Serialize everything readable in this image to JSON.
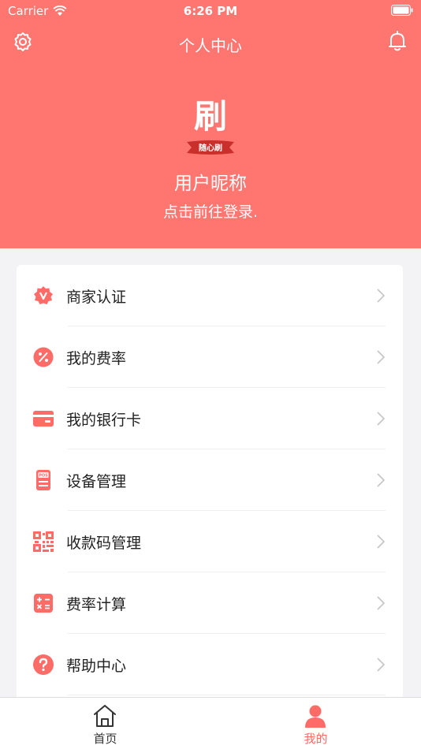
{
  "status_bar": {
    "carrier": "Carrier",
    "time": "6:26 PM"
  },
  "navbar": {
    "title": "个人中心",
    "icons": {
      "left": "settings-gear-icon",
      "right": "notification-bell-icon"
    }
  },
  "profile": {
    "logo_char": "刷",
    "logo_ribbon": "随心刷",
    "nickname": "用户昵称",
    "login_hint": "点击前往登录."
  },
  "menu": {
    "items": [
      {
        "label": "商家认证",
        "icon": "merchant-verify-badge-icon"
      },
      {
        "label": "我的费率",
        "icon": "percent-icon"
      },
      {
        "label": "我的银行卡",
        "icon": "bank-card-icon"
      },
      {
        "label": "设备管理",
        "icon": "pos-device-icon"
      },
      {
        "label": "收款码管理",
        "icon": "qr-code-icon"
      },
      {
        "label": "费率计算",
        "icon": "calculator-icon"
      },
      {
        "label": "帮助中心",
        "icon": "help-icon"
      }
    ]
  },
  "tabbar": {
    "tabs": [
      {
        "label": "首页",
        "icon": "home-icon",
        "active": false
      },
      {
        "label": "我的",
        "icon": "profile-icon",
        "active": true
      }
    ]
  },
  "colors": {
    "accent": "#ff7570",
    "background": "#f3f3f5",
    "text": "#222222",
    "inactive": "#333333"
  }
}
